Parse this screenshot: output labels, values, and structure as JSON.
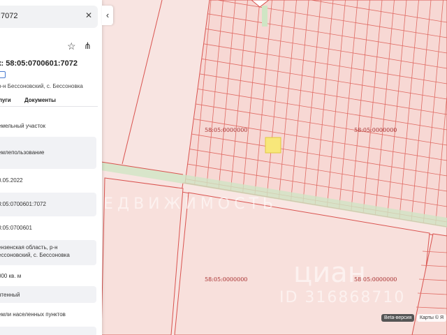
{
  "search": {
    "query": ":7072",
    "clear_icon": "close-icon"
  },
  "panel": {
    "title": "к: 58:05:0700601:7072",
    "address": "р-н Бессоновский, с. Бессоновка",
    "tabs": [
      "луги",
      "Документы"
    ],
    "rows": [
      {
        "text": "емельный участок"
      },
      {
        "text": "емлепользование"
      },
      {
        "text": "0.05.2022"
      },
      {
        "text": "8:05:0700601:7072"
      },
      {
        "text": "8:05:0700601"
      },
      {
        "text": "ензенская область, р-н",
        "text2": "ессоновский, с. Бессоновка"
      },
      {
        "text": "000 кв. м"
      },
      {
        "text": "нтенный"
      },
      {
        "text": "емли населенных пунктов"
      }
    ]
  },
  "map": {
    "labels": [
      "58:05:0000000",
      "58:05:0000000",
      "58:05:0000000",
      "58:05:0000000"
    ],
    "watermark_1": "ЕДВИЖИМОСТЬ",
    "watermark_2": "циан",
    "watermark_3": "ID 316868710",
    "beta_label": "Beta-версия",
    "maps_label": "Карты © Я",
    "colors": {
      "parcel_fill": "#f8dcd7",
      "parcel_stroke": "#d9534f",
      "road": "#cbe3c0",
      "highlight": "#f8e77a",
      "label": "#a52a2a"
    }
  }
}
